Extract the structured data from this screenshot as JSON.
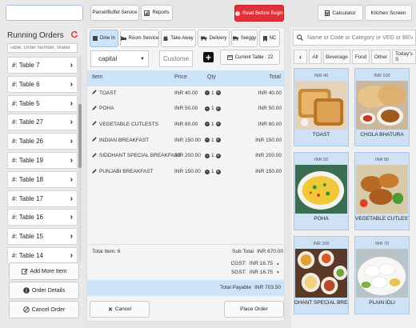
{
  "left": {
    "running_title": "Running Orders",
    "search_value": "",
    "table_search_placeholder": "Table, Order Number, Waiter",
    "tables": [
      "#: Table 7",
      "#: Table 6",
      "#: Table 5",
      "#: Table 27",
      "#: Table 26",
      "#: Table 19",
      "#: Table 18",
      "#: Table 17",
      "#: Table 16",
      "#: Table 15",
      "#: Table 14"
    ],
    "add_more": "Add More Item",
    "order_details": "Order Details",
    "cancel_order": "Cancel Order"
  },
  "top": {
    "parcel": "Parcel/Buffet Service",
    "reports": "Reports",
    "read_before": "Read Before Begin",
    "calculator": "Calculator",
    "kitchen": "Kitchen Screen"
  },
  "tabs": [
    "Dine In",
    "Room Service",
    "Take Away",
    "Delivery",
    "Swiggy",
    "NC"
  ],
  "area_select": "capital",
  "customer_placeholder": "Customer",
  "current_table": "Current Table : 22",
  "order": {
    "headers": {
      "item": "Item",
      "price": "Price",
      "qty": "Qty",
      "total": "Total"
    },
    "items": [
      {
        "name": "TOAST",
        "price": "INR 40.00",
        "qty": "1",
        "total": "INR 40.00"
      },
      {
        "name": "POHA",
        "price": "INR 50.00",
        "qty": "1",
        "total": "INR 50.00"
      },
      {
        "name": "VEGETABLE CUTLESTS",
        "price": "INR 80.00",
        "qty": "1",
        "total": "INR 80.00"
      },
      {
        "name": "INDIAN BREAKFAST",
        "price": "INR 150.00",
        "qty": "1",
        "total": "INR 150.00"
      },
      {
        "name": "SIDDHANT SPECIAL BREAKFAST",
        "price": "INR 200.00",
        "qty": "1",
        "total": "INR 200.00"
      },
      {
        "name": "PUNJABI BREAKFAST",
        "price": "INR 150.00",
        "qty": "1",
        "total": "INR 150.00"
      }
    ],
    "total_items": "Total Item: 6",
    "sub_total_label": "Sub Total",
    "sub_total": "INR 670.00",
    "cgst_label": "CGST:",
    "cgst": "INR 16.75",
    "sgst_label": "SGST:",
    "sgst": "INR 16.75",
    "payable_label": "Total Payable",
    "payable": "INR 703.50",
    "cancel": "Cancel",
    "place": "Place Order"
  },
  "menu": {
    "search_placeholder": "Name or Code or Category or VEG or BEV or",
    "categories": [
      "All",
      "Beverage",
      "Food",
      "Other",
      "Today's S"
    ],
    "products": [
      {
        "price": "INR 40",
        "name": "TOAST"
      },
      {
        "price": "INR 100",
        "name": "CHOLA BHATURA"
      },
      {
        "price": "INR 50",
        "name": "POHA"
      },
      {
        "price": "INR 80",
        "name": "VEGETABLE CUTLESTS"
      },
      {
        "price": "INR 200",
        "name": "DHANT SPECIAL BREAKF"
      },
      {
        "price": "INR 70",
        "name": "PLAIN IDLI"
      }
    ]
  },
  "colors": {
    "accent": "#4a90d9",
    "danger": "#e0303a",
    "panel": "#f4f4f4",
    "card": "#cfe1f5"
  }
}
